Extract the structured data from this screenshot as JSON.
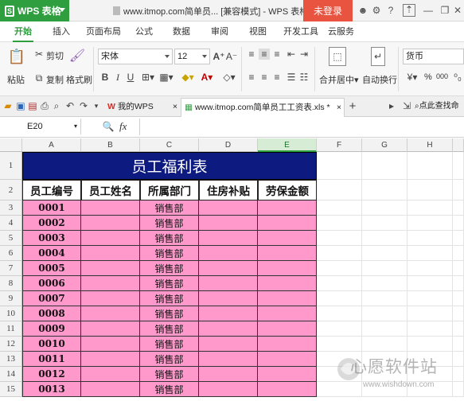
{
  "titlebar": {
    "app_name": "WPS 表格",
    "window_title": "www.itmop.com简单员... [兼容模式] - WPS 表格",
    "login_label": "未登录",
    "help_label": "?"
  },
  "tabs": [
    "开始",
    "插入",
    "页面布局",
    "公式",
    "数据",
    "审阅",
    "视图",
    "开发工具",
    "云服务"
  ],
  "ribbon": {
    "paste_label": "粘贴",
    "cut_label": "剪切",
    "copy_label": "复制",
    "format_painter_label": "格式刷",
    "font_name": "宋体",
    "font_size": "12",
    "merge_center_label": "合并居中",
    "wrap_text_label": "自动换行",
    "number_format": "货币",
    "percent_symbol": "%",
    "comma_symbol": "000"
  },
  "quickbar": {
    "doc_tab_1": "我的WPS",
    "doc_tab_2": "www.itmop.com简单员工工资表.xls *",
    "search_label": "点此查找命"
  },
  "formula_bar": {
    "cell_ref": "E20",
    "fx_label": "fx",
    "value": ""
  },
  "sheet": {
    "columns": [
      "A",
      "B",
      "C",
      "D",
      "E",
      "F",
      "G",
      "H"
    ],
    "selected_column": "E",
    "title": "员工福利表",
    "headers": [
      "员工编号",
      "员工姓名",
      "所属部门",
      "住房补贴",
      "劳保金额"
    ],
    "rows": [
      {
        "row": "3",
        "id": "0001",
        "dept": "销售部"
      },
      {
        "row": "4",
        "id": "0002",
        "dept": "销售部"
      },
      {
        "row": "5",
        "id": "0003",
        "dept": "销售部"
      },
      {
        "row": "6",
        "id": "0004",
        "dept": "销售部"
      },
      {
        "row": "7",
        "id": "0005",
        "dept": "销售部"
      },
      {
        "row": "8",
        "id": "0006",
        "dept": "销售部"
      },
      {
        "row": "9",
        "id": "0007",
        "dept": "销售部"
      },
      {
        "row": "10",
        "id": "0008",
        "dept": "销售部"
      },
      {
        "row": "11",
        "id": "0009",
        "dept": "销售部"
      },
      {
        "row": "12",
        "id": "0010",
        "dept": "销售部"
      },
      {
        "row": "13",
        "id": "0011",
        "dept": "销售部"
      },
      {
        "row": "14",
        "id": "0012",
        "dept": "销售部"
      },
      {
        "row": "15",
        "id": "0013",
        "dept": "销售部"
      }
    ],
    "row_labels_top": [
      "1",
      "2"
    ]
  },
  "watermark": {
    "text": "心愿软件站",
    "url": "www.wishdown.com"
  },
  "colors": {
    "app_green": "#2f9e3f",
    "login_red": "#e8543f",
    "title_fill": "#0d1a7f",
    "row_fill": "#ff99cc"
  }
}
